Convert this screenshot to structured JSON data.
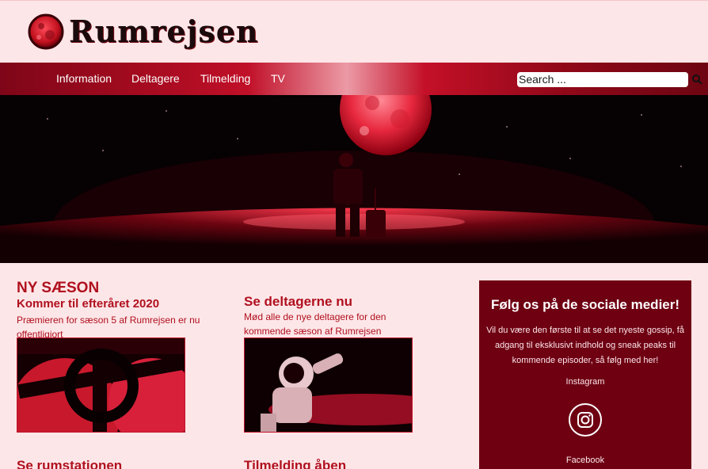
{
  "site": {
    "name": "Rumrejsen"
  },
  "nav": {
    "items": [
      "Information",
      "Deltagere",
      "Tilmelding",
      "TV"
    ],
    "search_placeholder": "Search ..."
  },
  "colors": {
    "brand_red": "#b0101e",
    "sidebar_bg": "#6e0012",
    "page_bg": "#fde6e8"
  },
  "main": {
    "season_heading": "NY SÆSON",
    "cards": [
      {
        "title": "Kommer til efteråret 2020",
        "text": "Præmieren for sæson 5 af Rumrejsen er nu offentligjort"
      },
      {
        "title": "Se deltagerne nu",
        "text": "Mød alle de nye deltagere for den kommende sæson af Rumrejsen"
      }
    ],
    "bottom_titles": [
      "Se rumstationen",
      "Tilmelding åben"
    ]
  },
  "sidebar": {
    "title": "Følg os på de sociale medier!",
    "text": "Vil du være den første til at se det nyeste gossip, få adgang til eksklusivt indhold og sneak peaks til kommende episoder, så følg med her!",
    "instagram_label": "Instagram",
    "facebook_label": "Facebook",
    "icons": [
      "instagram-icon"
    ]
  }
}
